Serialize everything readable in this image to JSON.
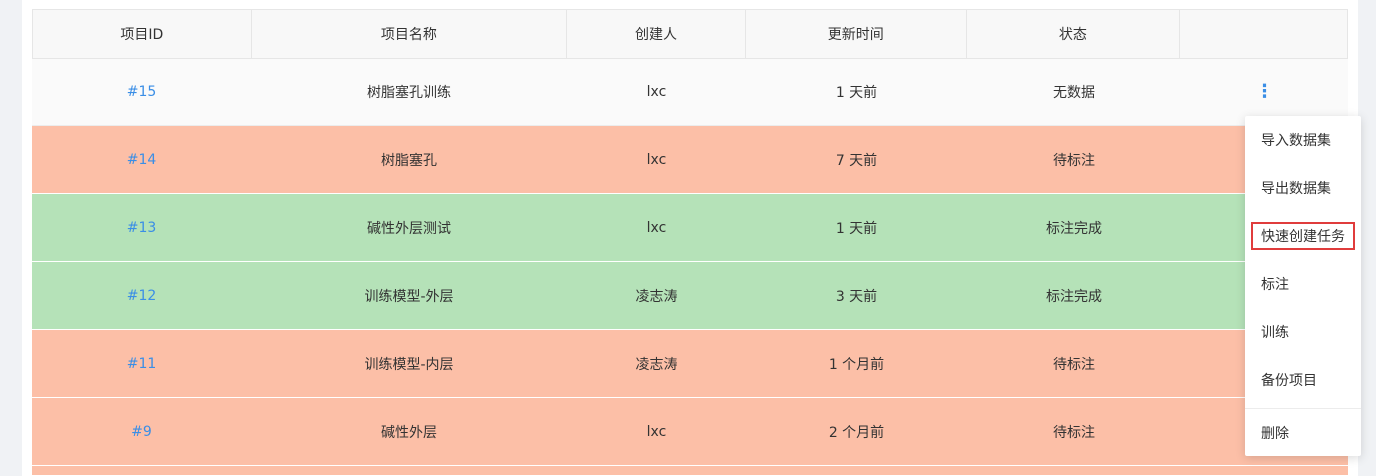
{
  "table": {
    "headers": [
      "项目ID",
      "项目名称",
      "创建人",
      "更新时间",
      "状态",
      ""
    ],
    "rows": [
      {
        "id": "#15",
        "name": "树脂塞孔训练",
        "creator": "lxc",
        "updated": "1 天前",
        "status": "无数据",
        "color": "#fafafa"
      },
      {
        "id": "#14",
        "name": "树脂塞孔",
        "creator": "lxc",
        "updated": "7 天前",
        "status": "待标注",
        "color": "#fcbfa7"
      },
      {
        "id": "#13",
        "name": "碱性外层测试",
        "creator": "lxc",
        "updated": "1 天前",
        "status": "标注完成",
        "color": "#b5e2b8"
      },
      {
        "id": "#12",
        "name": "训练模型-外层",
        "creator": "凌志涛",
        "updated": "3 天前",
        "status": "标注完成",
        "color": "#b5e2b8"
      },
      {
        "id": "#11",
        "name": "训练模型-内层",
        "creator": "凌志涛",
        "updated": "1 个月前",
        "status": "待标注",
        "color": "#fcbfa7"
      },
      {
        "id": "#9",
        "name": "碱性外层",
        "creator": "lxc",
        "updated": "2 个月前",
        "status": "待标注",
        "color": "#fcbfa7"
      }
    ],
    "more_icon": "⋮"
  },
  "menu": {
    "items": [
      "导入数据集",
      "导出数据集",
      "快速创建任务",
      "标注",
      "训练",
      "备份项目",
      "删除"
    ],
    "highlighted_index": 2
  },
  "colors": {
    "link": "#3a8ee6",
    "pending": "#fcbfa7",
    "done": "#b5e2b8",
    "highlight_border": "#e03c3c"
  }
}
